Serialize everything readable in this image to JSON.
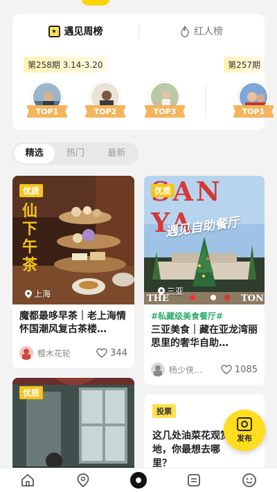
{
  "ranking": {
    "tabs": [
      {
        "label": "遇见周榜",
        "icon": "star-badge-icon",
        "active": true
      },
      {
        "label": "红人榜",
        "icon": "flame-icon",
        "active": false
      }
    ],
    "periods": [
      "第258期 3.14-3.20",
      "第257期"
    ],
    "badges": [
      "TOP1",
      "TOP2",
      "TOP3",
      "TOP1"
    ]
  },
  "filters": [
    {
      "label": "精选",
      "active": true
    },
    {
      "label": "热门",
      "active": false
    },
    {
      "label": "最新",
      "active": false
    }
  ],
  "feed": {
    "left": [
      {
        "badge": "优质",
        "image_text": "仙下午茶",
        "location": "上海",
        "title": "魔都最哆早茶｜老上海情怀国潮风复古茶楼…",
        "user": "樱木花轮",
        "likes": "344"
      },
      {
        "badge": "优质"
      }
    ],
    "right": [
      {
        "badge": "优质",
        "image_text_top": "SAN YA",
        "image_text_script": "遇见自助餐厅",
        "image_text_bottom_left": "THE",
        "image_text_bottom_right": "TON",
        "location": "三亚",
        "hashtag": "#私藏级美食餐厅#",
        "title": "三亚美食｜藏在亚龙湾丽思里的奢华自助…",
        "user": "杨少侠…",
        "likes": "1085"
      },
      {
        "badge": "投票",
        "title": "这几处油菜花观赏地，你最想去哪里？"
      }
    ]
  },
  "fab": {
    "label": "发布",
    "icon": "camera-icon"
  },
  "bottom_nav": [
    {
      "icon": "home-icon"
    },
    {
      "icon": "location-pin-icon"
    },
    {
      "icon": "center-dot-icon"
    },
    {
      "icon": "list-icon"
    },
    {
      "icon": "smile-face-icon"
    }
  ],
  "colors": {
    "accent": "#ffdd1f",
    "badge_orange": "#f4b45c",
    "hashtag_green": "#2fae6c"
  }
}
